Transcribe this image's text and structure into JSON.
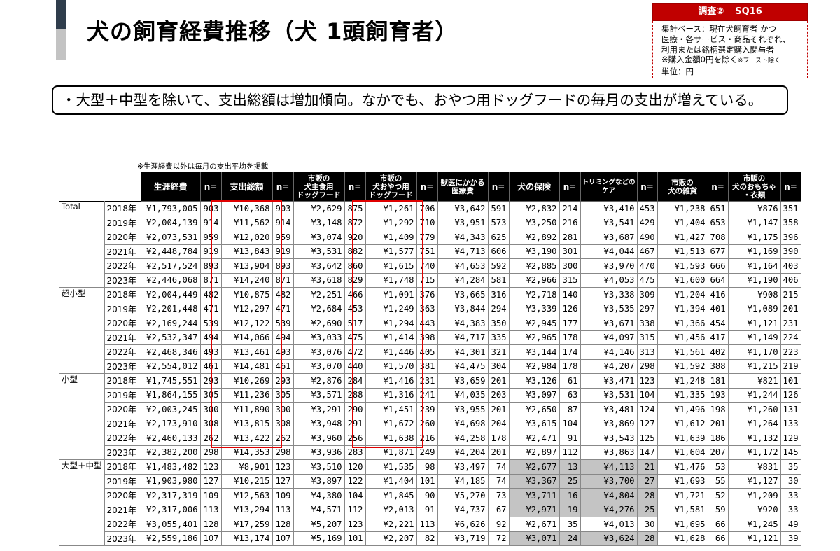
{
  "title": "犬の飼育経費推移（犬 1頭飼育者）",
  "survey": {
    "tag": "調査②",
    "code": "SQ16",
    "lines": [
      "集計ベース：現在犬飼育者 かつ",
      "医療・各サービス・商品それぞれ、",
      "利用または銘柄選定購入関与者",
      "※購入金額0円を除く",
      "単位：円"
    ],
    "small_note": "※ブースト除く"
  },
  "summary": "・大型＋中型を除いて、支出総額は増加傾向。なかでも、おやつ用ドッグフードの毎月の支出が増えている。",
  "note": "※生涯経費以外は毎月の支出平均を掲載",
  "table": {
    "headers": [
      "生涯経費",
      "n=",
      "支出総額",
      "n=",
      "市販の犬主食用ドッグフード",
      "n=",
      "市販の犬おやつ用ドッグフード",
      "n=",
      "獣医にかかる医療費",
      "n=",
      "犬の保険",
      "n=",
      "トリミングなどのケア",
      "n=",
      "市販の犬の雑貨",
      "n=",
      "市販の犬のおもちゃ・衣類",
      "n="
    ],
    "header_lines": [
      [
        "生涯経費"
      ],
      [
        "n="
      ],
      [
        "支出総額"
      ],
      [
        "n="
      ],
      [
        "市販の",
        "犬主食用",
        "ドッグフード"
      ],
      [
        "n="
      ],
      [
        "市販の",
        "犬おやつ用",
        "ドッグフード"
      ],
      [
        "n="
      ],
      [
        "獣医にかかる",
        "医療費"
      ],
      [
        "n="
      ],
      [
        "犬の保険"
      ],
      [
        "n="
      ],
      [
        "トリミングなどの",
        "ケア"
      ],
      [
        "n="
      ],
      [
        "市販の",
        "犬の雑貨"
      ],
      [
        "n="
      ],
      [
        "市販の",
        "犬のおもちゃ",
        "・衣類"
      ],
      [
        "n="
      ]
    ],
    "groups": [
      {
        "name": "Total",
        "rows": [
          {
            "year": "2018年",
            "cells": [
              "¥1,793,005",
              "903",
              "¥10,368",
              "903",
              "¥2,629",
              "875",
              "¥1,261",
              "706",
              "¥3,642",
              "591",
              "¥2,832",
              "214",
              "¥3,410",
              "453",
              "¥1,238",
              "651",
              "¥876",
              "351"
            ]
          },
          {
            "year": "2019年",
            "cells": [
              "¥2,004,139",
              "914",
              "¥11,562",
              "914",
              "¥3,148",
              "872",
              "¥1,292",
              "710",
              "¥3,951",
              "573",
              "¥3,250",
              "216",
              "¥3,541",
              "429",
              "¥1,404",
              "653",
              "¥1,147",
              "358"
            ]
          },
          {
            "year": "2020年",
            "cells": [
              "¥2,073,531",
              "959",
              "¥12,020",
              "959",
              "¥3,074",
              "920",
              "¥1,409",
              "779",
              "¥4,343",
              "625",
              "¥2,892",
              "281",
              "¥3,687",
              "490",
              "¥1,427",
              "708",
              "¥1,175",
              "396"
            ]
          },
          {
            "year": "2021年",
            "cells": [
              "¥2,448,784",
              "919",
              "¥13,843",
              "919",
              "¥3,531",
              "882",
              "¥1,577",
              "751",
              "¥4,713",
              "606",
              "¥3,190",
              "301",
              "¥4,044",
              "467",
              "¥1,513",
              "677",
              "¥1,169",
              "390"
            ]
          },
          {
            "year": "2022年",
            "cells": [
              "¥2,517,524",
              "893",
              "¥13,904",
              "893",
              "¥3,642",
              "860",
              "¥1,615",
              "740",
              "¥4,653",
              "592",
              "¥2,885",
              "300",
              "¥3,970",
              "470",
              "¥1,593",
              "666",
              "¥1,164",
              "403"
            ]
          },
          {
            "year": "2023年",
            "cells": [
              "¥2,446,068",
              "871",
              "¥14,240",
              "871",
              "¥3,618",
              "829",
              "¥1,748",
              "715",
              "¥4,284",
              "581",
              "¥2,966",
              "315",
              "¥4,053",
              "475",
              "¥1,600",
              "664",
              "¥1,190",
              "406"
            ]
          }
        ]
      },
      {
        "name": "超小型",
        "rows": [
          {
            "year": "2018年",
            "cells": [
              "¥2,004,449",
              "482",
              "¥10,875",
              "482",
              "¥2,251",
              "466",
              "¥1,091",
              "376",
              "¥3,665",
              "316",
              "¥2,718",
              "140",
              "¥3,338",
              "309",
              "¥1,204",
              "416",
              "¥908",
              "215"
            ]
          },
          {
            "year": "2019年",
            "cells": [
              "¥2,201,448",
              "471",
              "¥12,297",
              "471",
              "¥2,684",
              "453",
              "¥1,249",
              "363",
              "¥3,844",
              "294",
              "¥3,339",
              "126",
              "¥3,535",
              "297",
              "¥1,394",
              "401",
              "¥1,089",
              "201"
            ]
          },
          {
            "year": "2020年",
            "cells": [
              "¥2,169,244",
              "539",
              "¥12,122",
              "539",
              "¥2,690",
              "517",
              "¥1,294",
              "443",
              "¥4,383",
              "350",
              "¥2,945",
              "177",
              "¥3,671",
              "338",
              "¥1,366",
              "454",
              "¥1,121",
              "231"
            ]
          },
          {
            "year": "2021年",
            "cells": [
              "¥2,532,347",
              "494",
              "¥14,066",
              "494",
              "¥3,033",
              "475",
              "¥1,414",
              "398",
              "¥4,717",
              "335",
              "¥2,965",
              "178",
              "¥4,097",
              "315",
              "¥1,456",
              "417",
              "¥1,149",
              "224"
            ]
          },
          {
            "year": "2022年",
            "cells": [
              "¥2,468,346",
              "493",
              "¥13,461",
              "493",
              "¥3,076",
              "472",
              "¥1,446",
              "405",
              "¥4,301",
              "321",
              "¥3,144",
              "174",
              "¥4,146",
              "313",
              "¥1,561",
              "402",
              "¥1,170",
              "223"
            ]
          },
          {
            "year": "2023年",
            "cells": [
              "¥2,554,012",
              "461",
              "¥14,481",
              "461",
              "¥3,070",
              "440",
              "¥1,570",
              "381",
              "¥4,475",
              "304",
              "¥2,984",
              "178",
              "¥4,207",
              "298",
              "¥1,592",
              "388",
              "¥1,215",
              "219"
            ]
          }
        ]
      },
      {
        "name": "小型",
        "rows": [
          {
            "year": "2018年",
            "cells": [
              "¥1,745,551",
              "293",
              "¥10,269",
              "293",
              "¥2,876",
              "284",
              "¥1,416",
              "231",
              "¥3,659",
              "201",
              "¥3,126",
              "61",
              "¥3,471",
              "123",
              "¥1,248",
              "181",
              "¥821",
              "101"
            ]
          },
          {
            "year": "2019年",
            "cells": [
              "¥1,864,155",
              "305",
              "¥11,236",
              "305",
              "¥3,571",
              "288",
              "¥1,316",
              "241",
              "¥4,035",
              "203",
              "¥3,097",
              "63",
              "¥3,531",
              "104",
              "¥1,335",
              "193",
              "¥1,244",
              "126"
            ]
          },
          {
            "year": "2020年",
            "cells": [
              "¥2,003,245",
              "300",
              "¥11,890",
              "300",
              "¥3,291",
              "290",
              "¥1,451",
              "239",
              "¥3,955",
              "201",
              "¥2,650",
              "87",
              "¥3,481",
              "124",
              "¥1,496",
              "198",
              "¥1,260",
              "131"
            ]
          },
          {
            "year": "2021年",
            "cells": [
              "¥2,173,910",
              "308",
              "¥13,815",
              "308",
              "¥3,948",
              "291",
              "¥1,672",
              "260",
              "¥4,698",
              "204",
              "¥3,615",
              "104",
              "¥3,869",
              "127",
              "¥1,612",
              "201",
              "¥1,264",
              "133"
            ]
          },
          {
            "year": "2022年",
            "cells": [
              "¥2,460,133",
              "262",
              "¥13,422",
              "262",
              "¥3,960",
              "256",
              "¥1,638",
              "216",
              "¥4,258",
              "178",
              "¥2,471",
              "91",
              "¥3,543",
              "125",
              "¥1,639",
              "186",
              "¥1,132",
              "129"
            ]
          },
          {
            "year": "2023年",
            "cells": [
              "¥2,382,200",
              "298",
              "¥14,353",
              "298",
              "¥3,936",
              "283",
              "¥1,871",
              "249",
              "¥4,204",
              "201",
              "¥2,897",
              "112",
              "¥3,863",
              "147",
              "¥1,604",
              "207",
              "¥1,172",
              "145"
            ]
          }
        ]
      },
      {
        "name": "大型＋中型",
        "rows": [
          {
            "year": "2018年",
            "cells": [
              "¥1,483,482",
              "123",
              "¥8,901",
              "123",
              "¥3,510",
              "120",
              "¥1,535",
              "98",
              "¥3,497",
              "74",
              "¥2,677",
              "13",
              "¥4,113",
              "21",
              "¥1,476",
              "53",
              "¥831",
              "35"
            ]
          },
          {
            "year": "2019年",
            "cells": [
              "¥1,903,980",
              "127",
              "¥10,215",
              "127",
              "¥3,897",
              "122",
              "¥1,404",
              "101",
              "¥4,185",
              "74",
              "¥3,367",
              "25",
              "¥3,700",
              "27",
              "¥1,693",
              "55",
              "¥1,127",
              "30"
            ]
          },
          {
            "year": "2020年",
            "cells": [
              "¥2,317,319",
              "109",
              "¥12,563",
              "109",
              "¥4,380",
              "104",
              "¥1,845",
              "90",
              "¥5,270",
              "73",
              "¥3,711",
              "16",
              "¥4,804",
              "28",
              "¥1,721",
              "52",
              "¥1,209",
              "33"
            ]
          },
          {
            "year": "2021年",
            "cells": [
              "¥2,317,006",
              "113",
              "¥13,294",
              "113",
              "¥4,571",
              "112",
              "¥2,013",
              "91",
              "¥4,737",
              "67",
              "¥2,971",
              "19",
              "¥4,276",
              "25",
              "¥1,581",
              "59",
              "¥920",
              "33"
            ]
          },
          {
            "year": "2022年",
            "cells": [
              "¥3,055,401",
              "128",
              "¥17,259",
              "128",
              "¥5,207",
              "123",
              "¥2,221",
              "113",
              "¥6,626",
              "92",
              "¥2,671",
              "35",
              "¥4,013",
              "30",
              "¥1,695",
              "66",
              "¥1,245",
              "49"
            ]
          },
          {
            "year": "2023年",
            "cells": [
              "¥2,559,186",
              "107",
              "¥13,174",
              "107",
              "¥5,169",
              "101",
              "¥2,207",
              "82",
              "¥3,719",
              "72",
              "¥3,071",
              "24",
              "¥3,624",
              "28",
              "¥1,628",
              "66",
              "¥1,121",
              "39"
            ]
          }
        ]
      }
    ],
    "shaded": [
      [
        3,
        0,
        10
      ],
      [
        3,
        0,
        11
      ],
      [
        3,
        0,
        12
      ],
      [
        3,
        0,
        13
      ],
      [
        3,
        1,
        10
      ],
      [
        3,
        1,
        11
      ],
      [
        3,
        1,
        12
      ],
      [
        3,
        1,
        13
      ],
      [
        3,
        2,
        10
      ],
      [
        3,
        2,
        11
      ],
      [
        3,
        2,
        12
      ],
      [
        3,
        2,
        13
      ],
      [
        3,
        3,
        10
      ],
      [
        3,
        3,
        11
      ],
      [
        3,
        3,
        12
      ],
      [
        3,
        3,
        13
      ],
      [
        3,
        5,
        10
      ],
      [
        3,
        5,
        11
      ],
      [
        3,
        5,
        12
      ],
      [
        3,
        5,
        13
      ]
    ]
  },
  "colors": {
    "accent": "#c00000",
    "highlight": "#e00000",
    "header_bg": "#000000",
    "shade": "#c4c4c4"
  }
}
